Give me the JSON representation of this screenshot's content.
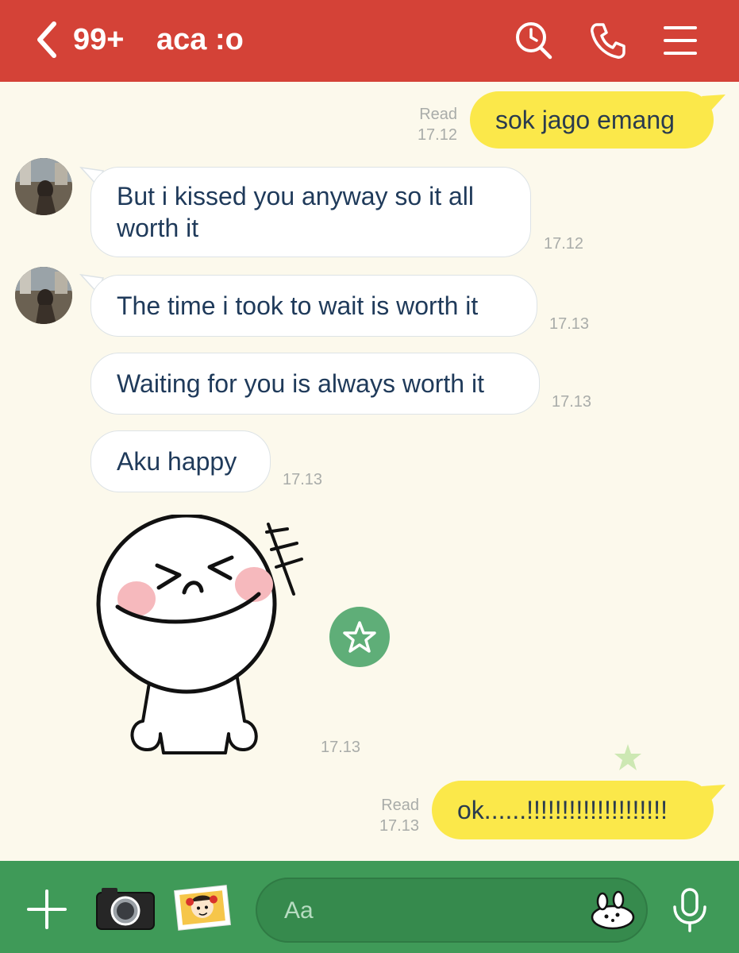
{
  "header": {
    "unread_count": "99+",
    "title": "aca :o",
    "icons": [
      "back-icon",
      "search-icon",
      "phone-icon",
      "menu-icon"
    ]
  },
  "messages": {
    "m1": {
      "text": "sok jago emang",
      "status": "Read",
      "time": "17.12"
    },
    "m2": {
      "text": "But i kissed you anyway so it all worth it",
      "time": "17.12"
    },
    "m3": {
      "text": "The time i took to wait is worth it",
      "time": "17.13"
    },
    "m4": {
      "text": "Waiting for you is always worth it",
      "time": "17.13"
    },
    "m5": {
      "text": "Aku happy",
      "time": "17.13"
    },
    "sticker": {
      "icon": "laughing-face-sticker",
      "time": "17.13"
    },
    "m6": {
      "text": "ok......!!!!!!!!!!!!!!!!!!!!",
      "status": "Read",
      "time": "17.13"
    }
  },
  "footer": {
    "input_placeholder": "Aa",
    "icons": [
      "plus-icon",
      "camera-icon",
      "photo-gallery-icon",
      "sticker-icon",
      "microphone-icon"
    ]
  },
  "colors": {
    "header_bg": "#d44237",
    "chat_bg": "#fcf9ec",
    "outgoing_bubble": "#fbe84a",
    "incoming_bubble": "#ffffff",
    "footer_bg": "#3f9a58",
    "favorite_button": "#5fae78"
  }
}
